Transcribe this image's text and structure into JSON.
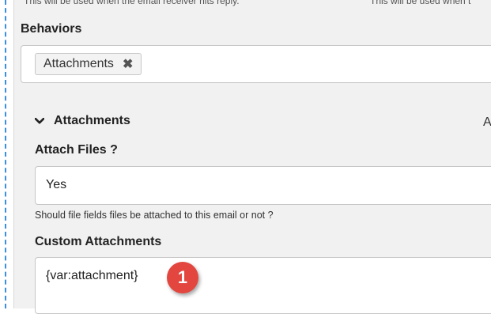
{
  "top_hints": {
    "left": "This will be used when the email receiver hits reply.",
    "right": "This will be used when t"
  },
  "behaviors": {
    "label": "Behaviors",
    "tag": "Attachments",
    "remove_symbol": "✖"
  },
  "attachments_section": {
    "title": "Attachments",
    "right_cut_text": "A"
  },
  "attach_files": {
    "label": "Attach Files ?",
    "value": "Yes",
    "help": "Should file fields files be attached to this email or not ?"
  },
  "custom_attachments": {
    "label": "Custom Attachments",
    "value": "{var:attachment}"
  },
  "callout": {
    "number": "1",
    "color": "#e2463f"
  },
  "colors": {
    "dashed_border": "#3b8ee0",
    "panel_bg": "#f1f1f1"
  }
}
